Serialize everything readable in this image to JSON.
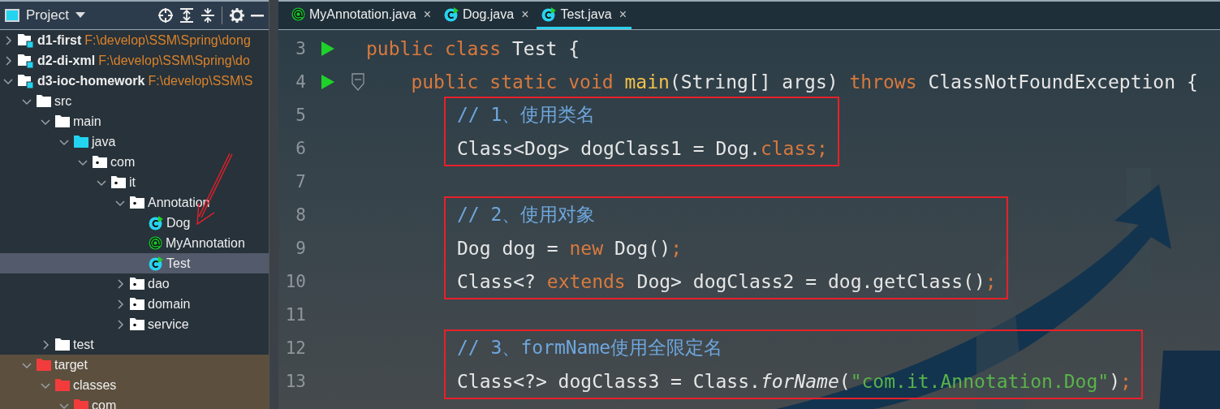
{
  "project_panel": {
    "title": "Project",
    "tree": [
      {
        "label": "d1-first",
        "path": "F:\\develop\\SSM\\Spring\\dong",
        "kind": "module",
        "expanded": false,
        "selected": false
      },
      {
        "label": "d2-di-xml",
        "path": "F:\\develop\\SSM\\Spring\\do",
        "kind": "module",
        "expanded": false,
        "selected": false
      },
      {
        "label": "d3-ioc-homework",
        "path": "F:\\develop\\SSM\\S",
        "kind": "module",
        "expanded": true,
        "selected": false,
        "children": [
          {
            "label": "src",
            "kind": "folder",
            "expanded": true,
            "selected": false,
            "children": [
              {
                "label": "main",
                "kind": "folder",
                "expanded": true,
                "selected": false,
                "children": [
                  {
                    "label": "java",
                    "kind": "source",
                    "expanded": true,
                    "selected": false,
                    "children": [
                      {
                        "label": "com",
                        "kind": "package",
                        "expanded": true,
                        "selected": false,
                        "children": [
                          {
                            "label": "it",
                            "kind": "package",
                            "expanded": true,
                            "selected": false,
                            "children": [
                              {
                                "label": "Annotation",
                                "kind": "package",
                                "expanded": true,
                                "selected": false,
                                "children": [
                                  {
                                    "label": "Dog",
                                    "kind": "class",
                                    "selected": false
                                  },
                                  {
                                    "label": "MyAnnotation",
                                    "kind": "annotation",
                                    "selected": false
                                  },
                                  {
                                    "label": "Test",
                                    "kind": "class",
                                    "selected": true
                                  }
                                ]
                              },
                              {
                                "label": "dao",
                                "kind": "package",
                                "expanded": false,
                                "selected": false
                              },
                              {
                                "label": "domain",
                                "kind": "package",
                                "expanded": false,
                                "selected": false
                              },
                              {
                                "label": "service",
                                "kind": "package",
                                "expanded": false,
                                "selected": false
                              }
                            ]
                          }
                        ]
                      }
                    ]
                  }
                ]
              },
              {
                "label": "test",
                "kind": "folder",
                "expanded": false,
                "selected": false
              }
            ]
          },
          {
            "label": "target",
            "kind": "excluded",
            "expanded": true,
            "selected": false,
            "children": [
              {
                "label": "classes",
                "kind": "excluded",
                "expanded": true,
                "selected": false,
                "children": [
                  {
                    "label": "com",
                    "kind": "excluded",
                    "expanded": true,
                    "selected": false
                  }
                ]
              }
            ]
          }
        ]
      }
    ]
  },
  "tabs": [
    {
      "label": "MyAnnotation.java",
      "kind": "annotation",
      "selected": false,
      "close": "×"
    },
    {
      "label": "Dog.java",
      "kind": "class",
      "selected": false,
      "close": "×"
    },
    {
      "label": "Test.java",
      "kind": "class",
      "selected": true,
      "close": "×"
    }
  ],
  "editor": {
    "blocks": [
      {
        "boxed": false,
        "lines": [
          {
            "number": "3",
            "run": true,
            "fold": false,
            "tokens": [
              {
                "kind": "keyword",
                "text": "public class "
              },
              {
                "kind": "plain",
                "text": "Test {"
              }
            ]
          },
          {
            "number": "4",
            "run": true,
            "fold": true,
            "tokens": [
              {
                "kind": "keyword",
                "text": "    public static void "
              },
              {
                "kind": "method",
                "text": "main"
              },
              {
                "kind": "plain",
                "text": "(String[] args) "
              },
              {
                "kind": "keyword",
                "text": "throws "
              },
              {
                "kind": "plain",
                "text": "ClassNotFoundException {"
              }
            ]
          }
        ]
      },
      {
        "boxed": true,
        "lines": [
          {
            "number": "5",
            "run": false,
            "fold": false,
            "tokens": [
              {
                "kind": "comment",
                "text": "// 1、使用类名"
              }
            ]
          },
          {
            "number": "6",
            "run": false,
            "fold": false,
            "tokens": [
              {
                "kind": "plain",
                "text": "Class<Dog> dogClass1 = Dog."
              },
              {
                "kind": "keyword",
                "text": "class;"
              }
            ]
          }
        ]
      },
      {
        "boxed": false,
        "lines": [
          {
            "number": "7",
            "run": false,
            "fold": false
          }
        ]
      },
      {
        "boxed": true,
        "lines": [
          {
            "number": "8",
            "run": false,
            "fold": false,
            "tokens": [
              {
                "kind": "comment",
                "text": "// 2、使用对象"
              }
            ]
          },
          {
            "number": "9",
            "run": false,
            "fold": false,
            "tokens": [
              {
                "kind": "plain",
                "text": "Dog dog = "
              },
              {
                "kind": "keyword",
                "text": "new "
              },
              {
                "kind": "plain",
                "text": "Dog()"
              },
              {
                "kind": "keyword",
                "text": ";"
              }
            ]
          },
          {
            "number": "10",
            "run": false,
            "fold": false,
            "tokens": [
              {
                "kind": "plain",
                "text": "Class<? "
              },
              {
                "kind": "keyword",
                "text": "extends "
              },
              {
                "kind": "plain",
                "text": "Dog> dogClass2 = dog.getClass()"
              },
              {
                "kind": "keyword",
                "text": ";"
              }
            ]
          }
        ]
      },
      {
        "boxed": false,
        "lines": [
          {
            "number": "11",
            "run": false,
            "fold": false
          }
        ]
      },
      {
        "boxed": true,
        "lines": [
          {
            "number": "12",
            "run": false,
            "fold": false,
            "tokens": [
              {
                "kind": "comment",
                "text": "// 3、formName使用全限定名"
              }
            ]
          },
          {
            "number": "13",
            "run": false,
            "fold": false,
            "tokens": [
              {
                "kind": "plain",
                "text": "Class<?> dogClass3 = Class."
              },
              {
                "kind": "static",
                "text": "forName"
              },
              {
                "kind": "plain",
                "text": "("
              },
              {
                "kind": "string",
                "text": "\"com.it.Annotation.Dog\""
              },
              {
                "kind": "plain",
                "text": ")"
              },
              {
                "kind": "keyword",
                "text": ";"
              }
            ]
          }
        ]
      }
    ]
  }
}
